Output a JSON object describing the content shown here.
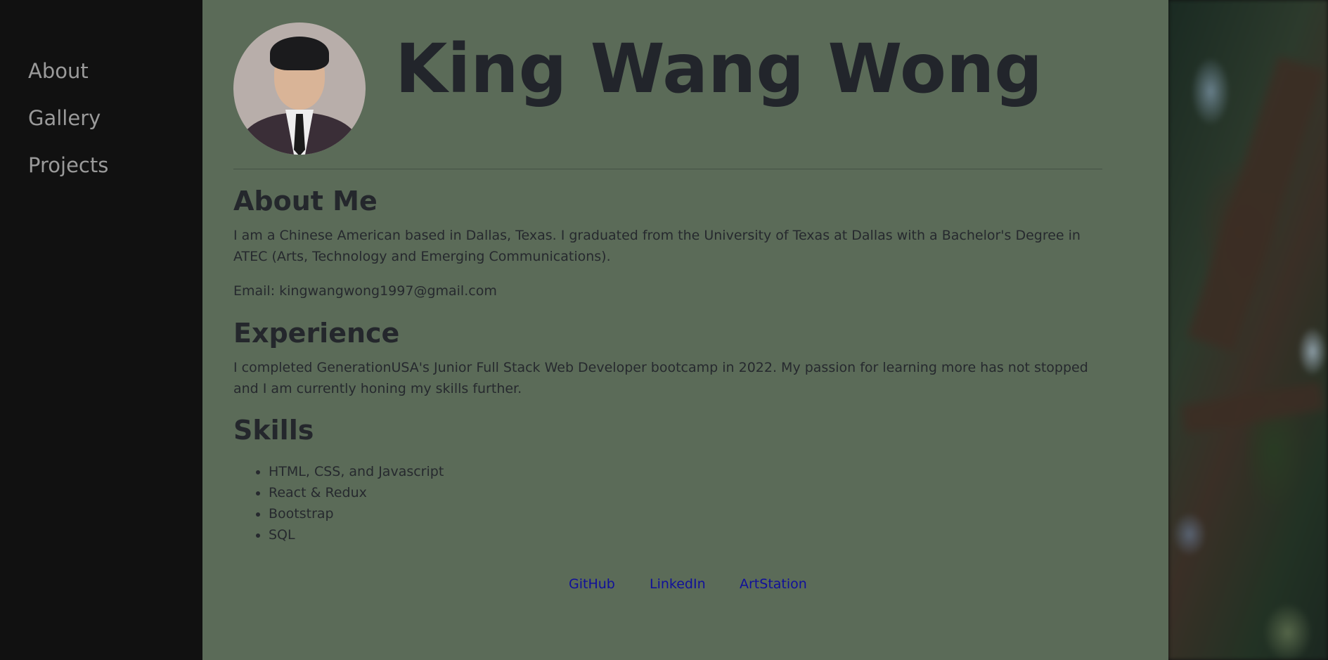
{
  "sidebar": {
    "items": [
      {
        "label": "About"
      },
      {
        "label": "Gallery"
      },
      {
        "label": "Projects"
      }
    ]
  },
  "header": {
    "name": "King Wang Wong"
  },
  "about": {
    "heading": "About Me",
    "bio": "I am a Chinese American based in Dallas, Texas. I graduated from the University of Texas at Dallas with a Bachelor's Degree in ATEC (Arts, Technology and Emerging Communications).",
    "email": "Email: kingwangwong1997@gmail.com"
  },
  "experience": {
    "heading": "Experience",
    "text": "I completed GenerationUSA's Junior Full Stack Web Developer bootcamp in 2022. My passion for learning more has not stopped and I am currently honing my skills further."
  },
  "skills": {
    "heading": "Skills",
    "items": [
      "HTML, CSS, and Javascript",
      "React & Redux",
      "Bootstrap",
      "SQL"
    ]
  },
  "footer": {
    "links": [
      {
        "label": "GitHub"
      },
      {
        "label": "LinkedIn"
      },
      {
        "label": "ArtStation"
      }
    ]
  },
  "colors": {
    "sidebar_bg": "#111111",
    "main_bg": "#5b6b58",
    "text": "#24272c",
    "link": "#10109a",
    "nav_text": "#9a9a9a"
  }
}
